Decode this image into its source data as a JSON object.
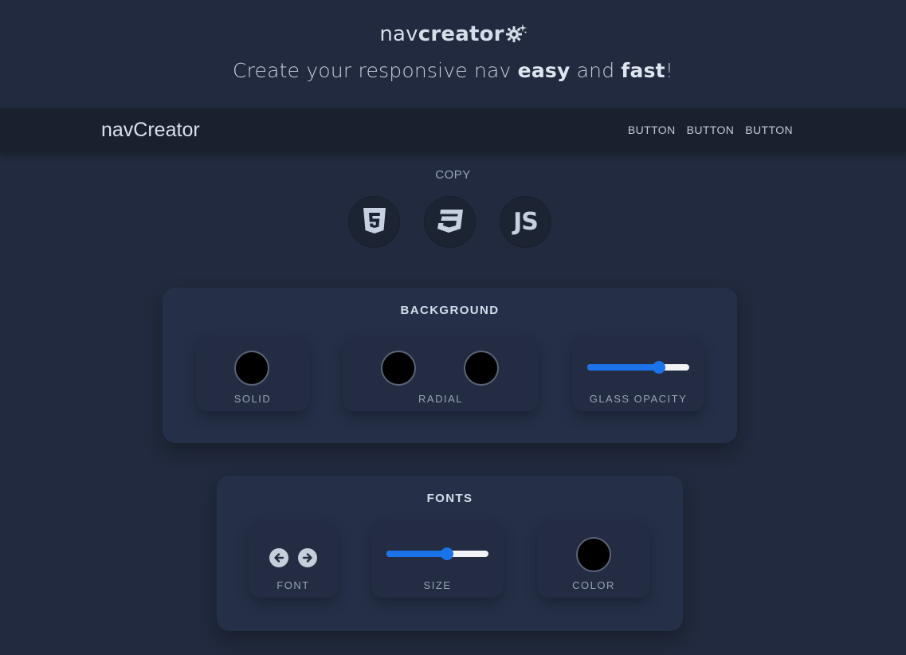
{
  "header": {
    "brand_light": "nav",
    "brand_bold": "creator",
    "brand_icon": "gear-sparkle-icon",
    "tagline_1": "Create your responsive nav ",
    "tagline_easy": "easy",
    "tagline_2": " and ",
    "tagline_fast": "fast",
    "tagline_3": "!"
  },
  "preview_nav": {
    "logo": "navCreator",
    "buttons": [
      "BUTTON",
      "BUTTON",
      "BUTTON"
    ],
    "background": "#1a202e"
  },
  "copy": {
    "label": "COPY",
    "buttons": [
      {
        "icon": "html5-icon"
      },
      {
        "icon": "css3-icon"
      },
      {
        "icon": "js-icon",
        "text": "JS"
      }
    ]
  },
  "background_panel": {
    "title": "BACKGROUND",
    "solid": {
      "label": "SOLID",
      "color": "#000000"
    },
    "radial": {
      "label": "RADIAL",
      "color_1": "#000000",
      "color_2": "#000000"
    },
    "glass_opacity": {
      "label": "GLASS OPACITY",
      "value": 0.7
    }
  },
  "fonts_panel": {
    "title": "FONTS",
    "font": {
      "label": "FONT",
      "prev_icon": "arrow-left-icon",
      "next_icon": "arrow-right-icon"
    },
    "size": {
      "label": "SIZE",
      "value": 0.59
    },
    "color": {
      "label": "COLOR",
      "value": "#000000"
    }
  },
  "colors": {
    "page_bg": "#212a3e",
    "accent": "#1a73e8"
  }
}
